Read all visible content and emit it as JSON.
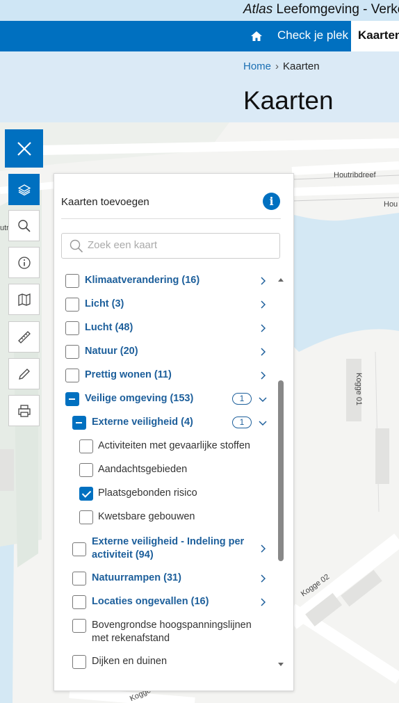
{
  "site": {
    "title_italic": "Atlas",
    "title_rest": " Leefomgeving - Verke"
  },
  "nav": {
    "home_icon": "home-icon",
    "check_label": "Check je plek",
    "active_label": "Kaarten"
  },
  "breadcrumb": {
    "home": "Home",
    "separator": "›",
    "current": "Kaarten"
  },
  "page": {
    "title": "Kaarten"
  },
  "map": {
    "streets": [
      "Houtribdreef",
      "Hou",
      "Kogge 01",
      "Kogge 02",
      "Kogge",
      "utri"
    ]
  },
  "toolbar": {
    "close_icon": "close-icon",
    "tools": [
      "layers-icon",
      "search-icon",
      "info-icon",
      "map-book-icon",
      "ruler-icon",
      "pencil-icon",
      "printer-icon"
    ]
  },
  "panel": {
    "title": "Kaarten toevoegen",
    "info_label": "i",
    "search_placeholder": "Zoek een kaart",
    "items": [
      {
        "label": "Klimaatverandering (16)",
        "type": "category",
        "state": "unchecked"
      },
      {
        "label": "Licht (3)",
        "type": "category",
        "state": "unchecked"
      },
      {
        "label": "Lucht (48)",
        "type": "category",
        "state": "unchecked"
      },
      {
        "label": "Natuur (20)",
        "type": "category",
        "state": "unchecked"
      },
      {
        "label": "Prettig wonen (11)",
        "type": "category",
        "state": "unchecked"
      },
      {
        "label": "Veilige omgeving (153)",
        "type": "category",
        "state": "partial",
        "badge": "1",
        "expanded": true
      },
      {
        "label": "Externe veiligheid (4)",
        "type": "subcategory",
        "state": "partial",
        "badge": "1",
        "expanded": true
      },
      {
        "label": "Activiteiten met gevaarlijke stoffen",
        "type": "leaf",
        "state": "unchecked"
      },
      {
        "label": "Aandachtsgebieden",
        "type": "leaf",
        "state": "unchecked"
      },
      {
        "label": "Plaatsgebonden risico",
        "type": "leaf",
        "state": "checked"
      },
      {
        "label": "Kwetsbare gebouwen",
        "type": "leaf",
        "state": "unchecked"
      },
      {
        "label": "Externe veiligheid - Indeling per activiteit (94)",
        "type": "subcategory",
        "state": "unchecked"
      },
      {
        "label": "Natuurrampen (31)",
        "type": "subcategory",
        "state": "unchecked"
      },
      {
        "label": "Locaties ongevallen (16)",
        "type": "subcategory",
        "state": "unchecked"
      },
      {
        "label": "Bovengrondse hoogspanningslijnen met rekenafstand",
        "type": "leaf-sub",
        "state": "unchecked"
      },
      {
        "label": "Dijken en duinen",
        "type": "leaf-sub",
        "state": "unchecked"
      }
    ]
  },
  "colors": {
    "primary": "#0070c0",
    "link": "#1d5f9b",
    "header_bg": "#dbeaf6",
    "water": "#d4e8f4",
    "green": "#e2ebe3"
  }
}
